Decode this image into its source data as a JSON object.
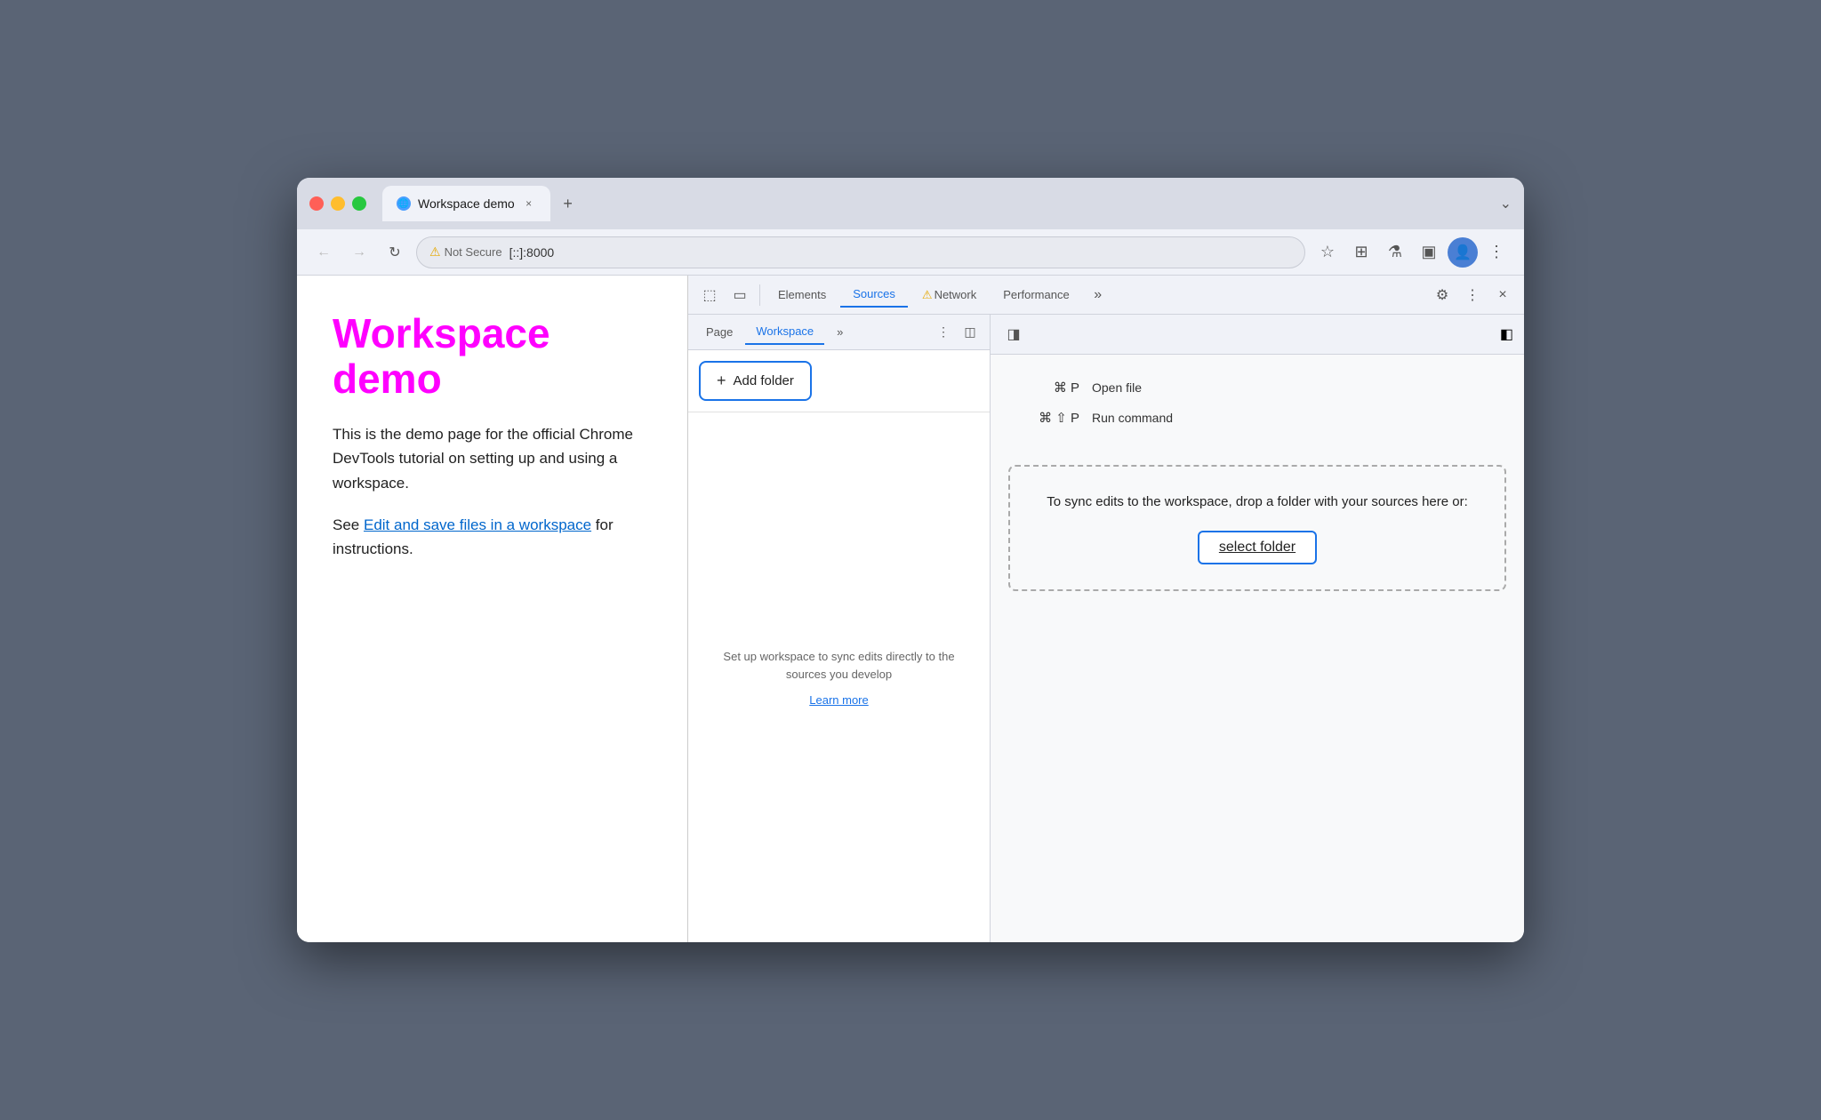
{
  "browser": {
    "tab_title": "Workspace demo",
    "tab_favicon": "🌐",
    "tab_close": "×",
    "tab_new": "+",
    "tab_end_chevron": "⌄",
    "nav_back": "←",
    "nav_forward": "→",
    "nav_refresh": "↻",
    "address_warning": "⚠",
    "address_not_secure": "Not Secure",
    "address_url": "[::]:8000",
    "nav_star": "☆",
    "nav_puzzle": "⊞",
    "nav_flask": "⚗",
    "nav_split": "▣",
    "nav_profile": "👤",
    "nav_more": "⋮"
  },
  "webpage": {
    "title": "Workspace demo",
    "description_1": "This is the demo page for the official Chrome DevTools tutorial on setting up and using a workspace.",
    "description_2": "See ",
    "link_text": "Edit and save files in a workspace",
    "description_3": " for instructions."
  },
  "devtools": {
    "toolbar": {
      "inspect_icon": "⬚",
      "device_icon": "▭",
      "elements_tab": "Elements",
      "sources_tab": "Sources",
      "network_warning": "⚠",
      "network_tab": "Network",
      "performance_tab": "Performance",
      "more_tabs": "»",
      "settings_icon": "⚙",
      "more_icon": "⋮",
      "close_icon": "×"
    },
    "sources": {
      "page_tab": "Page",
      "workspace_tab": "Workspace",
      "more_tabs": "»",
      "more_icon": "⋮",
      "panel_icon": "◫",
      "add_folder_label": "Add folder",
      "workspace_info": "Set up workspace to\nsync edits directly to the\nsources you develop",
      "learn_more": "Learn more",
      "shortcut_open_file_keys": "⌘ P",
      "shortcut_open_file_label": "Open file",
      "shortcut_run_cmd_keys": "⌘ ⇧ P",
      "shortcut_run_cmd_label": "Run command",
      "drop_zone_text": "To sync edits to the workspace, drop\na folder with your sources here or:",
      "select_folder_label": "select folder",
      "right_panel_icon": "◨",
      "collapse_icon": "◧"
    }
  }
}
